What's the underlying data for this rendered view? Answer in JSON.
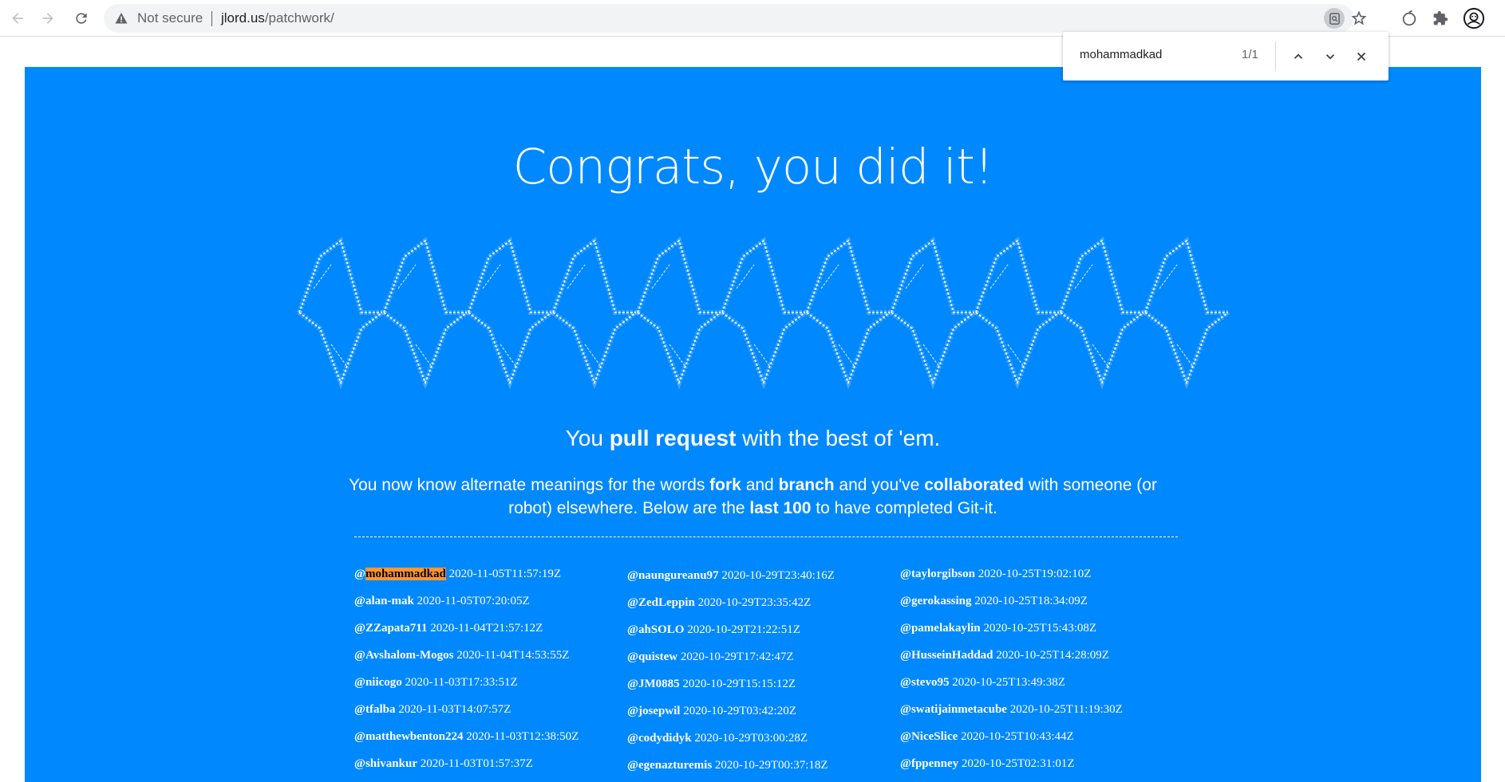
{
  "browser": {
    "security_label": "Not secure",
    "url_domain": "jlord.us",
    "url_path": "/patchwork/",
    "find": {
      "query": "mohammadkad",
      "count": "1/1"
    },
    "icons": [
      "back-arrow-icon",
      "forward-arrow-icon",
      "reload-icon",
      "warning-icon",
      "find-in-page-icon",
      "star-icon",
      "extension-apple-icon",
      "puzzle-piece-icon",
      "profile-avatar-icon"
    ]
  },
  "page": {
    "headline": "Congrats, you did it!",
    "ascii_art_colors": {
      "stroke": "#ffffff",
      "glow": "#bfe3ff"
    },
    "tagline": {
      "before": "You ",
      "bold": "pull request",
      "after": " with the best of 'em."
    },
    "description": {
      "t1": "You now know alternate meanings for the words ",
      "b1": "fork",
      "t2": " and ",
      "b2": "branch",
      "t3": " and you've ",
      "b3": "collaborated",
      "t4": " with someone (or robot) elsewhere. Below are the ",
      "b4": "last 100",
      "t5": " to have completed Git-it."
    },
    "completions": [
      [
        {
          "user": "@mohammadkad",
          "time": "2020-11-05T11:57:19Z"
        },
        {
          "user": "@alan-mak",
          "time": "2020-11-05T07:20:05Z"
        },
        {
          "user": "@ZZapata711",
          "time": "2020-11-04T21:57:12Z"
        },
        {
          "user": "@Avshalom-Mogos",
          "time": "2020-11-04T14:53:55Z"
        },
        {
          "user": "@niicogo",
          "time": "2020-11-03T17:33:51Z"
        },
        {
          "user": "@tfalba",
          "time": "2020-11-03T14:07:57Z"
        },
        {
          "user": "@matthewbenton224",
          "time": "2020-11-03T12:38:50Z"
        },
        {
          "user": "@shivankur",
          "time": "2020-11-03T01:57:37Z"
        }
      ],
      [
        {
          "user": "@naungureanu97",
          "time": "2020-10-29T23:40:16Z"
        },
        {
          "user": "@ZedLeppin",
          "time": "2020-10-29T23:35:42Z"
        },
        {
          "user": "@ahSOLO",
          "time": "2020-10-29T21:22:51Z"
        },
        {
          "user": "@quistew",
          "time": "2020-10-29T17:42:47Z"
        },
        {
          "user": "@JM0885",
          "time": "2020-10-29T15:15:12Z"
        },
        {
          "user": "@josepwil",
          "time": "2020-10-29T03:42:20Z"
        },
        {
          "user": "@codydidyk",
          "time": "2020-10-29T03:00:28Z"
        },
        {
          "user": "@egenazturemis",
          "time": "2020-10-29T00:37:18Z"
        }
      ],
      [
        {
          "user": "@taylorgibson",
          "time": "2020-10-25T19:02:10Z"
        },
        {
          "user": "@gerokassing",
          "time": "2020-10-25T18:34:09Z"
        },
        {
          "user": "@pamelakaylin",
          "time": "2020-10-25T15:43:08Z"
        },
        {
          "user": "@HusseinHaddad",
          "time": "2020-10-25T14:28:09Z"
        },
        {
          "user": "@stevo95",
          "time": "2020-10-25T13:49:38Z"
        },
        {
          "user": "@swatijainmetacube",
          "time": "2020-10-25T11:19:30Z"
        },
        {
          "user": "@NiceSlice",
          "time": "2020-10-25T10:43:44Z"
        },
        {
          "user": "@fppenney",
          "time": "2020-10-25T02:31:01Z"
        }
      ]
    ]
  }
}
